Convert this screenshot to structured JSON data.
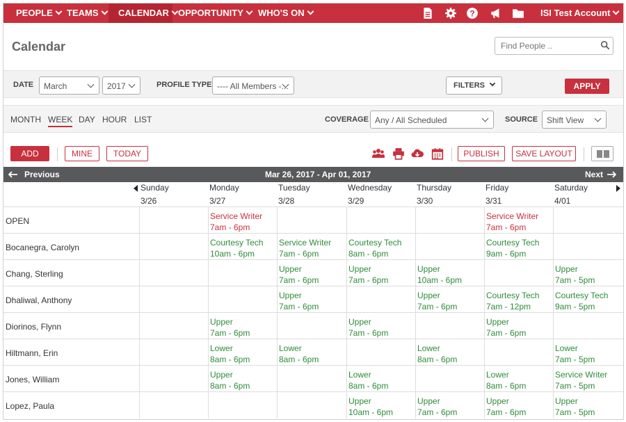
{
  "nav": {
    "items": [
      {
        "label": "PEOPLE",
        "active": false
      },
      {
        "label": "TEAMS",
        "active": false
      },
      {
        "label": "CALENDAR",
        "active": true
      },
      {
        "label": "OPPORTUNITY",
        "active": false
      },
      {
        "label": "WHO'S ON",
        "active": false
      }
    ],
    "icons": [
      "document-icon",
      "gear-icon",
      "help-icon",
      "megaphone-icon",
      "folder-icon"
    ],
    "account": "ISI Test Account"
  },
  "page": {
    "title": "Calendar",
    "search_placeholder": "Find People .."
  },
  "filters": {
    "date_label": "DATE",
    "month": "March",
    "year": "2017",
    "profile_type_label": "PROFILE TYPE",
    "profile_type": "---- All Members -...",
    "filters_button": "FILTERS",
    "apply_button": "APPLY"
  },
  "views": {
    "tabs": [
      "MONTH",
      "WEEK",
      "DAY",
      "HOUR",
      "LIST"
    ],
    "active": "WEEK",
    "coverage_label": "COVERAGE",
    "coverage": "Any / All Scheduled",
    "source_label": "SOURCE",
    "source": "Shift View"
  },
  "toolbar": {
    "add": "ADD",
    "mine": "MINE",
    "today": "TODAY",
    "publish": "PUBLISH",
    "save_layout": "SAVE LAYOUT",
    "icons": [
      "people-icon",
      "print-icon",
      "cloud-download-icon",
      "calendar-icon"
    ]
  },
  "calendar": {
    "previous": "Previous",
    "next": "Next",
    "range": "Mar 26, 2017 - Apr 01, 2017",
    "days": [
      {
        "name": "Sunday",
        "date": "3/26"
      },
      {
        "name": "Monday",
        "date": "3/27"
      },
      {
        "name": "Tuesday",
        "date": "3/28"
      },
      {
        "name": "Wednesday",
        "date": "3/29"
      },
      {
        "name": "Thursday",
        "date": "3/30"
      },
      {
        "name": "Friday",
        "date": "3/31"
      },
      {
        "name": "Saturday",
        "date": "4/01"
      }
    ],
    "rows": [
      {
        "name": "OPEN",
        "shifts": [
          null,
          {
            "role": "Service Writer",
            "time": "7am - 6pm",
            "color": "#c8303d"
          },
          null,
          null,
          null,
          {
            "role": "Service Writer",
            "time": "7am - 6pm",
            "color": "#c8303d"
          },
          null
        ]
      },
      {
        "name": "Bocanegra, Carolyn",
        "shifts": [
          null,
          {
            "role": "Courtesy Tech",
            "time": "10am - 6pm",
            "color": "#2e8b3a"
          },
          {
            "role": "Service Writer",
            "time": "7am - 6pm",
            "color": "#2e8b3a"
          },
          {
            "role": "Courtesy Tech",
            "time": "8am - 6pm",
            "color": "#2e8b3a"
          },
          null,
          {
            "role": "Courtesy Tech",
            "time": "9am - 6pm",
            "color": "#2e8b3a"
          },
          null
        ]
      },
      {
        "name": "Chang, Sterling",
        "shifts": [
          null,
          null,
          {
            "role": "Upper",
            "time": "7am - 6pm",
            "color": "#2e8b3a"
          },
          {
            "role": "Upper",
            "time": "7am - 6pm",
            "color": "#2e8b3a"
          },
          {
            "role": "Upper",
            "time": "10am - 6pm",
            "color": "#2e8b3a"
          },
          null,
          {
            "role": "Upper",
            "time": "7am - 5pm",
            "color": "#2e8b3a"
          }
        ]
      },
      {
        "name": "Dhaliwal, Anthony",
        "shifts": [
          null,
          null,
          {
            "role": "Upper",
            "time": "7am - 6pm",
            "color": "#2e8b3a"
          },
          null,
          {
            "role": "Upper",
            "time": "7am - 6pm",
            "color": "#2e8b3a"
          },
          {
            "role": "Courtesy Tech",
            "time": "7am - 12pm",
            "color": "#2e8b3a"
          },
          {
            "role": "Courtesy Tech",
            "time": "9am - 5pm",
            "color": "#2e8b3a"
          }
        ]
      },
      {
        "name": "Diorinos, Flynn",
        "shifts": [
          null,
          {
            "role": "Upper",
            "time": "7am - 6pm",
            "color": "#2e8b3a"
          },
          null,
          {
            "role": "Upper",
            "time": "7am - 6pm",
            "color": "#2e8b3a"
          },
          null,
          {
            "role": "Upper",
            "time": "7am - 6pm",
            "color": "#2e8b3a"
          },
          null
        ]
      },
      {
        "name": "Hiltmann, Erin",
        "shifts": [
          null,
          {
            "role": "Lower",
            "time": "8am - 6pm",
            "color": "#2e8b3a"
          },
          {
            "role": "Lower",
            "time": "8am - 6pm",
            "color": "#2e8b3a"
          },
          null,
          {
            "role": "Lower",
            "time": "8am - 6pm",
            "color": "#2e8b3a"
          },
          null,
          {
            "role": "Lower",
            "time": "7am - 5pm",
            "color": "#2e8b3a"
          }
        ]
      },
      {
        "name": "Jones, William",
        "shifts": [
          null,
          {
            "role": "Upper",
            "time": "8am - 6pm",
            "color": "#2e8b3a"
          },
          null,
          {
            "role": "Lower",
            "time": "8am - 6pm",
            "color": "#2e8b3a"
          },
          null,
          {
            "role": "Lower",
            "time": "8am - 6pm",
            "color": "#2e8b3a"
          },
          {
            "role": "Service Writer",
            "time": "7am - 5pm",
            "color": "#2e8b3a"
          }
        ]
      },
      {
        "name": "Lopez, Paula",
        "shifts": [
          null,
          null,
          null,
          {
            "role": "Upper",
            "time": "10am - 6pm",
            "color": "#2e8b3a"
          },
          {
            "role": "Upper",
            "time": "7am - 6pm",
            "color": "#2e8b3a"
          },
          {
            "role": "Upper",
            "time": "7am - 6pm",
            "color": "#2e8b3a"
          },
          {
            "role": "Upper",
            "time": "7am - 5pm",
            "color": "#2e8b3a"
          }
        ]
      }
    ]
  }
}
